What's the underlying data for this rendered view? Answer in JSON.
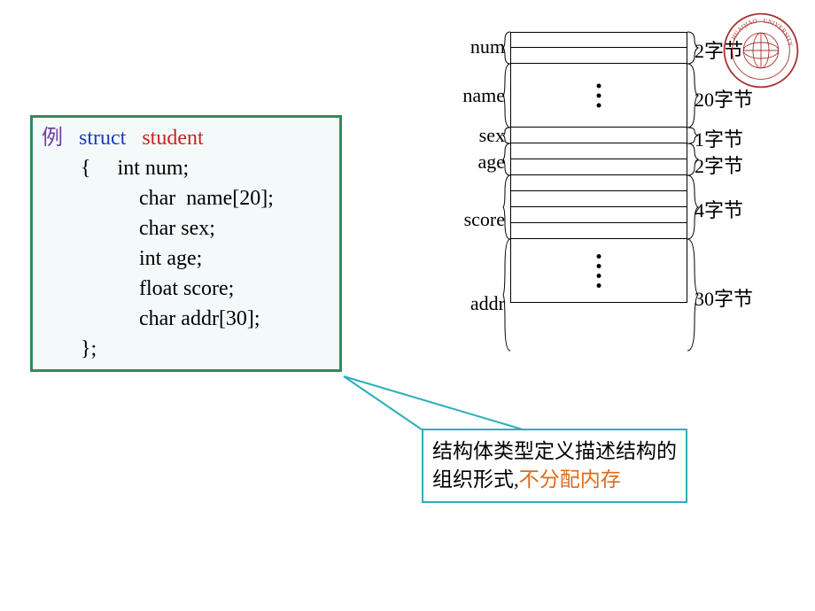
{
  "code": {
    "example_label": "例",
    "struct_kw": "struct",
    "struct_name": "student",
    "open": "{",
    "line1a": "int num;",
    "line2": "char  name[20];",
    "line3": "char sex;",
    "line4": "int age;",
    "line5": "float score;",
    "line6": "char addr[30];",
    "close": "};"
  },
  "diagram": {
    "fields": [
      {
        "name": "num",
        "size": "2字节"
      },
      {
        "name": "name",
        "size": "20字节"
      },
      {
        "name": "sex",
        "size": "1字节"
      },
      {
        "name": "age",
        "size": "2字节"
      },
      {
        "name": "score",
        "size": "4字节"
      },
      {
        "name": "addr",
        "size": "30字节"
      }
    ]
  },
  "callout": {
    "text_plain": "结构体类型定义描述结构的组织形式,",
    "text_orange": "不分配内存"
  }
}
